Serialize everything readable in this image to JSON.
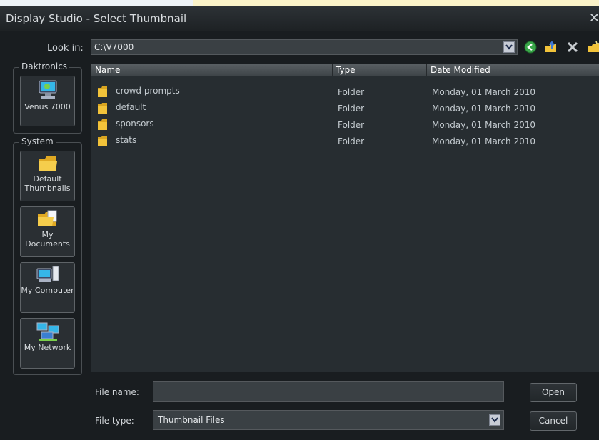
{
  "window": {
    "title": "Display Studio - Select Thumbnail",
    "close_label": "✕"
  },
  "lookin": {
    "label": "Look in:",
    "path": "C:\\V7000"
  },
  "toolbar": {
    "icons": [
      "back-icon",
      "up-folder-icon",
      "delete-icon",
      "new-folder-icon"
    ]
  },
  "places": {
    "daktronics": {
      "group_label": "Daktronics",
      "items": [
        {
          "label": "Venus 7000",
          "icon": "computer-icon"
        }
      ]
    },
    "system": {
      "group_label": "System",
      "items": [
        {
          "label": "Default Thumbnails",
          "icon": "folder-icon"
        },
        {
          "label": "My Documents",
          "icon": "documents-folder-icon"
        },
        {
          "label": "My Computer",
          "icon": "computer-icon"
        },
        {
          "label": "My Network",
          "icon": "network-icon"
        }
      ]
    }
  },
  "file_list": {
    "columns": [
      "Name",
      "Type",
      "Date Modified"
    ],
    "rows": [
      {
        "name": "crowd prompts",
        "type": "Folder",
        "date": "Monday, 01 March 2010"
      },
      {
        "name": "default",
        "type": "Folder",
        "date": "Monday, 01 March 2010"
      },
      {
        "name": "sponsors",
        "type": "Folder",
        "date": "Monday, 01 March 2010"
      },
      {
        "name": "stats",
        "type": "Folder",
        "date": "Monday, 01 March 2010"
      }
    ]
  },
  "filename": {
    "label": "File name:",
    "value": ""
  },
  "filetype": {
    "label": "File type:",
    "value": "Thumbnail Files"
  },
  "buttons": {
    "open": "Open",
    "cancel": "Cancel"
  },
  "colors": {
    "dialog_bg": "#191d20",
    "list_bg": "#272d31",
    "folder": "#f2c33a"
  }
}
